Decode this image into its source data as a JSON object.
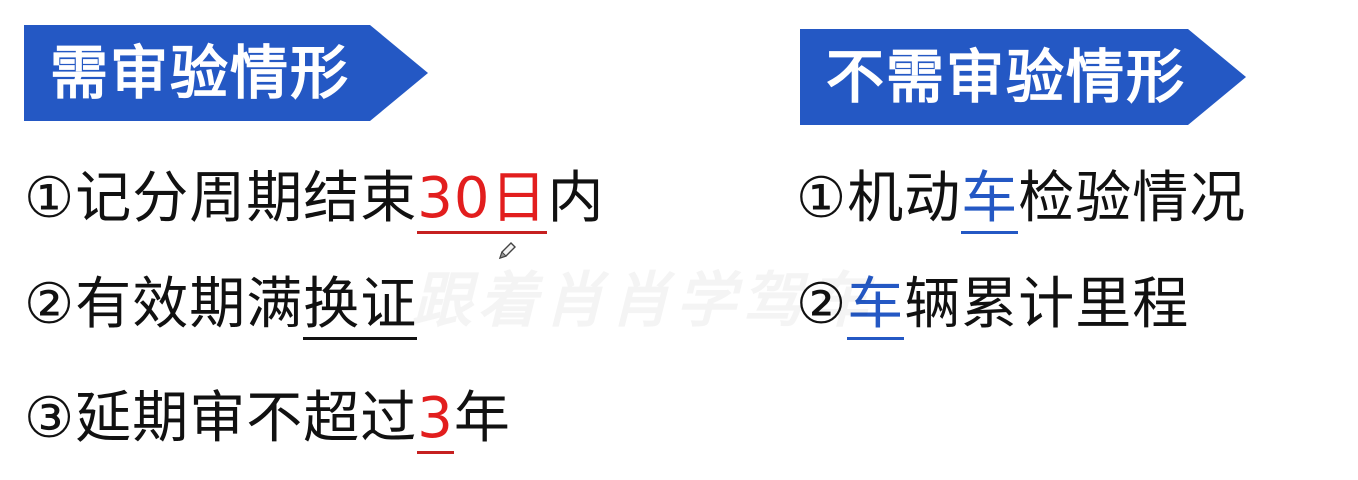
{
  "left": {
    "title": "需审验情形",
    "items": [
      {
        "num": "①",
        "pre": "记分周期结束",
        "hl": "30日",
        "post": "内"
      },
      {
        "num": "②",
        "pre": "有效期满",
        "hl": "换证",
        "post": ""
      },
      {
        "num": "③",
        "pre": "延期审不超过",
        "hl": "3",
        "post": "年"
      }
    ]
  },
  "right": {
    "title": "不需审验情形",
    "items": [
      {
        "num": "①",
        "pre": "机动",
        "hl": "车",
        "post": "检验情况"
      },
      {
        "num": "②",
        "pre": "",
        "hl": "车",
        "post": "辆累计里程"
      }
    ]
  },
  "watermark": "跟着肖肖学驾车",
  "colors": {
    "banner": "#2458c4",
    "red": "#e21e1e",
    "blue": "#2458c4",
    "text": "#111111"
  },
  "icons": {
    "cursor": "pencil-cursor-icon"
  }
}
